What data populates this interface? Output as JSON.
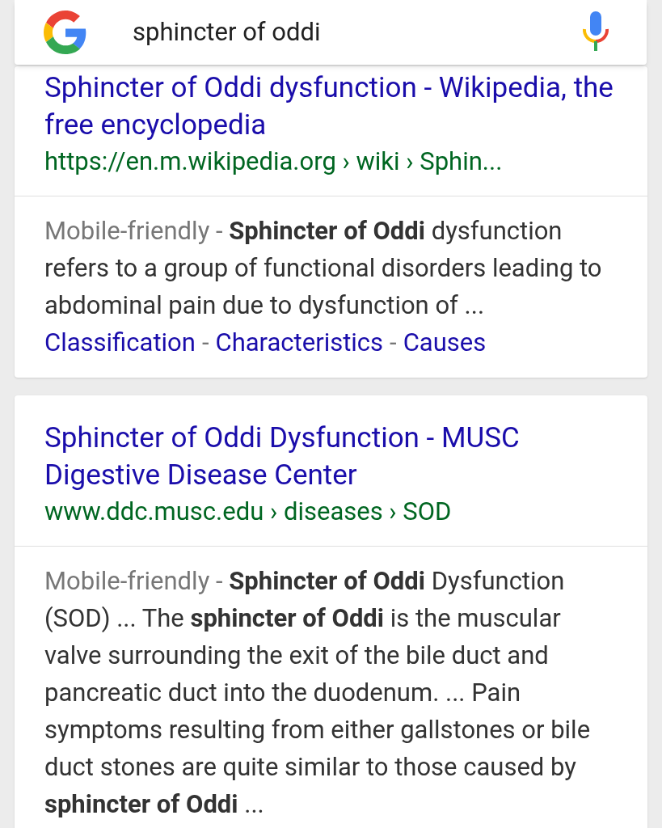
{
  "search": {
    "query": "sphincter of oddi"
  },
  "results": [
    {
      "title": "Sphincter of Oddi dysfunction - Wikipedia, the free encyclopedia",
      "url": "https://en.m.wikipedia.org › wiki › Sphin...",
      "label": "Mobile-friendly -",
      "snippet": "**Sphincter of Oddi** dysfunction refers to a group of functional disorders leading to abdominal pain due to dysfunction of ...",
      "links": [
        "Classification",
        "Characteristics",
        "Causes"
      ],
      "link_separator": "-"
    },
    {
      "title": "Sphincter of Oddi Dysfunction - MUSC Digestive Disease Center",
      "url": "www.ddc.musc.edu › diseases › SOD",
      "label": "Mobile-friendly -",
      "snippet": "**Sphincter of Oddi** Dysfunction (SOD) ... The **sphincter of Oddi** is the muscular valve surrounding the exit of the bile duct and pancreatic duct into the duodenum. ... Pain symptoms resulting from either gallstones or bile duct stones are quite similar to those caused by **sphincter of Oddi** ..."
    }
  ]
}
